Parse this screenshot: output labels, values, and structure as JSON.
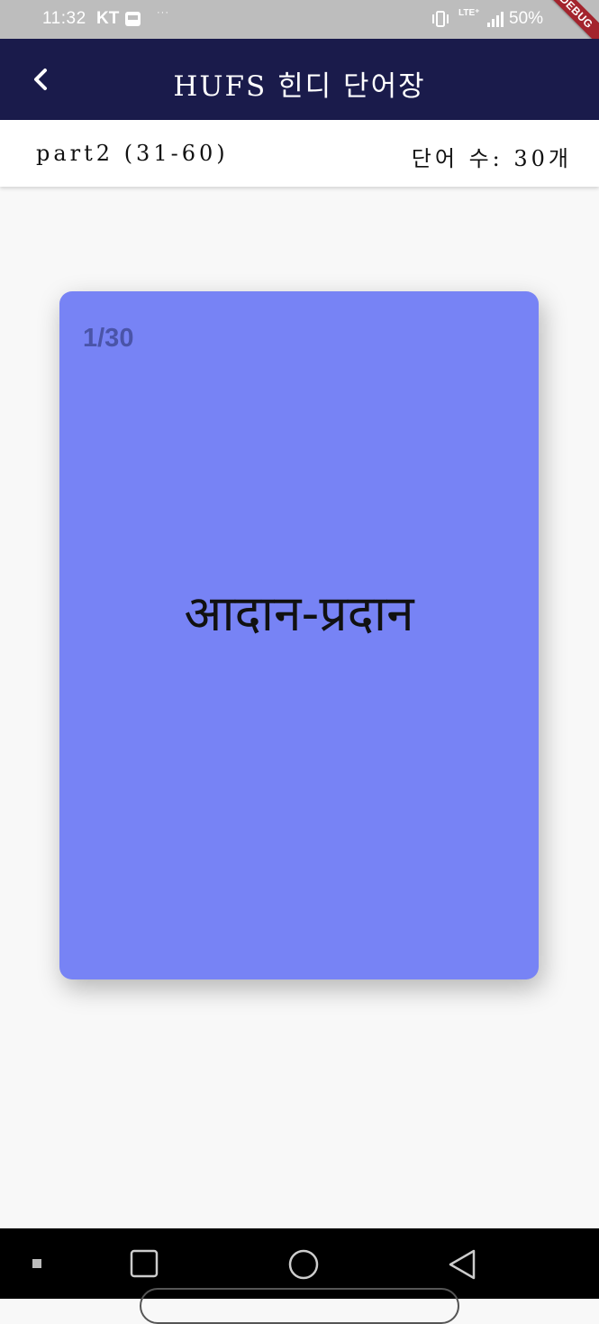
{
  "status_bar": {
    "time": "11:32",
    "carrier": "KT",
    "dots": "···",
    "lte": "LTE⁺",
    "battery": "50%",
    "debug_label": "DEBUG"
  },
  "app_bar": {
    "title": "HUFS 힌디 단어장",
    "back_icon": "chevron-left-icon"
  },
  "sub_header": {
    "part": "part2 (31-60)",
    "count_label": "단어 수: 30개"
  },
  "card": {
    "counter": "1/30",
    "word": "आदान-प्रदान",
    "color": "#7783f5"
  },
  "nav_bar": {
    "recents_icon": "square-icon",
    "home_icon": "circle-icon",
    "back_icon": "triangle-back-icon"
  },
  "colors": {
    "app_bar": "#1a1b4b",
    "card": "#7783f5",
    "card_counter": "#4a54a8",
    "background": "#f8f8f8"
  }
}
